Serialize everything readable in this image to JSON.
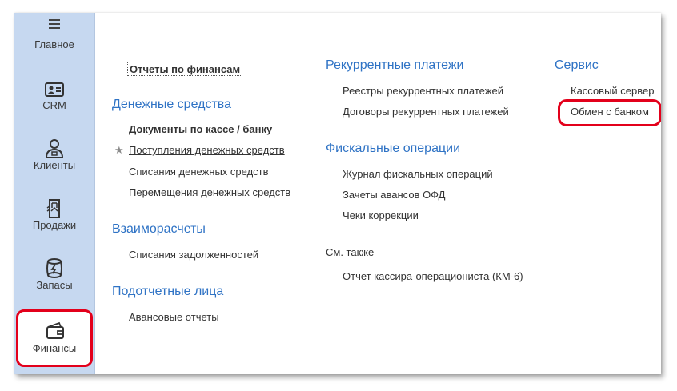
{
  "sidebar": {
    "items": [
      {
        "label": "Главное",
        "icon": "hamburger-menu-icon"
      },
      {
        "label": "CRM",
        "icon": "contact-card-icon"
      },
      {
        "label": "Клиенты",
        "icon": "person-icon"
      },
      {
        "label": "Продажи",
        "icon": "pos-terminal-icon"
      },
      {
        "label": "Запасы",
        "icon": "barrel-icon"
      },
      {
        "label": "Финансы",
        "icon": "wallet-icon",
        "active": true
      }
    ]
  },
  "main": {
    "col1": {
      "reports_link": "Отчеты по финансам",
      "sections": [
        {
          "title": "Денежные средства",
          "links": [
            "Документы по кассе / банку",
            "Поступления денежных средств",
            "Списания денежных средств",
            "Перемещения денежных средств"
          ]
        },
        {
          "title": "Взаиморасчеты",
          "links": [
            "Списания задолженностей"
          ]
        },
        {
          "title": "Подотчетные лица",
          "links": [
            "Авансовые отчеты"
          ]
        }
      ]
    },
    "col2": {
      "sections": [
        {
          "title": "Рекуррентные платежи",
          "links": [
            "Реестры рекуррентных платежей",
            "Договоры рекуррентных платежей"
          ]
        },
        {
          "title": "Фискальные операции",
          "links": [
            "Журнал фискальных операций",
            "Зачеты авансов ОФД",
            "Чеки коррекции"
          ]
        }
      ],
      "see_also_label": "См. также",
      "see_also_links": [
        "Отчет кассира-операциониста (КМ-6)"
      ]
    },
    "col3": {
      "sections": [
        {
          "title": "Сервис",
          "links": [
            "Кассовый сервер",
            "Обмен с банком"
          ]
        }
      ]
    }
  },
  "colors": {
    "sidebar_bg": "#c6d8f0",
    "section_title": "#2f73c5",
    "highlight": "#e3001b"
  }
}
